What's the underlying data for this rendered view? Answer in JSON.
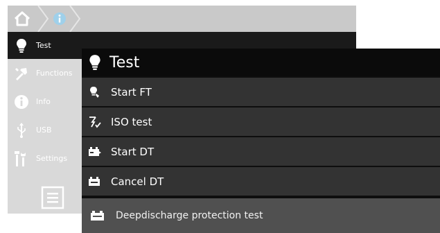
{
  "sidebar": {
    "items": [
      {
        "label": "Test",
        "icon": "lightbulb-icon",
        "active": true
      },
      {
        "label": "Functions",
        "icon": "tools-icon"
      },
      {
        "label": "Info",
        "icon": "info-icon"
      },
      {
        "label": "USB",
        "icon": "usb-icon"
      },
      {
        "label": "Settings",
        "icon": "settings-icon"
      }
    ]
  },
  "popup": {
    "title": "Test",
    "items": [
      {
        "label": "Start FT",
        "icon": "function-test-icon"
      },
      {
        "label": "ISO test",
        "icon": "iso-test-icon"
      },
      {
        "label": "Start DT",
        "icon": "battery-start-icon"
      },
      {
        "label": "Cancel DT",
        "icon": "battery-cancel-icon"
      },
      {
        "label": "Deepdischarge protection test",
        "icon": "battery-icon"
      }
    ]
  },
  "colors": {
    "accent": "#9fd0ea",
    "header_bg": "#0b0b0b",
    "item_bg": "#333333",
    "selected_bg": "#505050"
  }
}
